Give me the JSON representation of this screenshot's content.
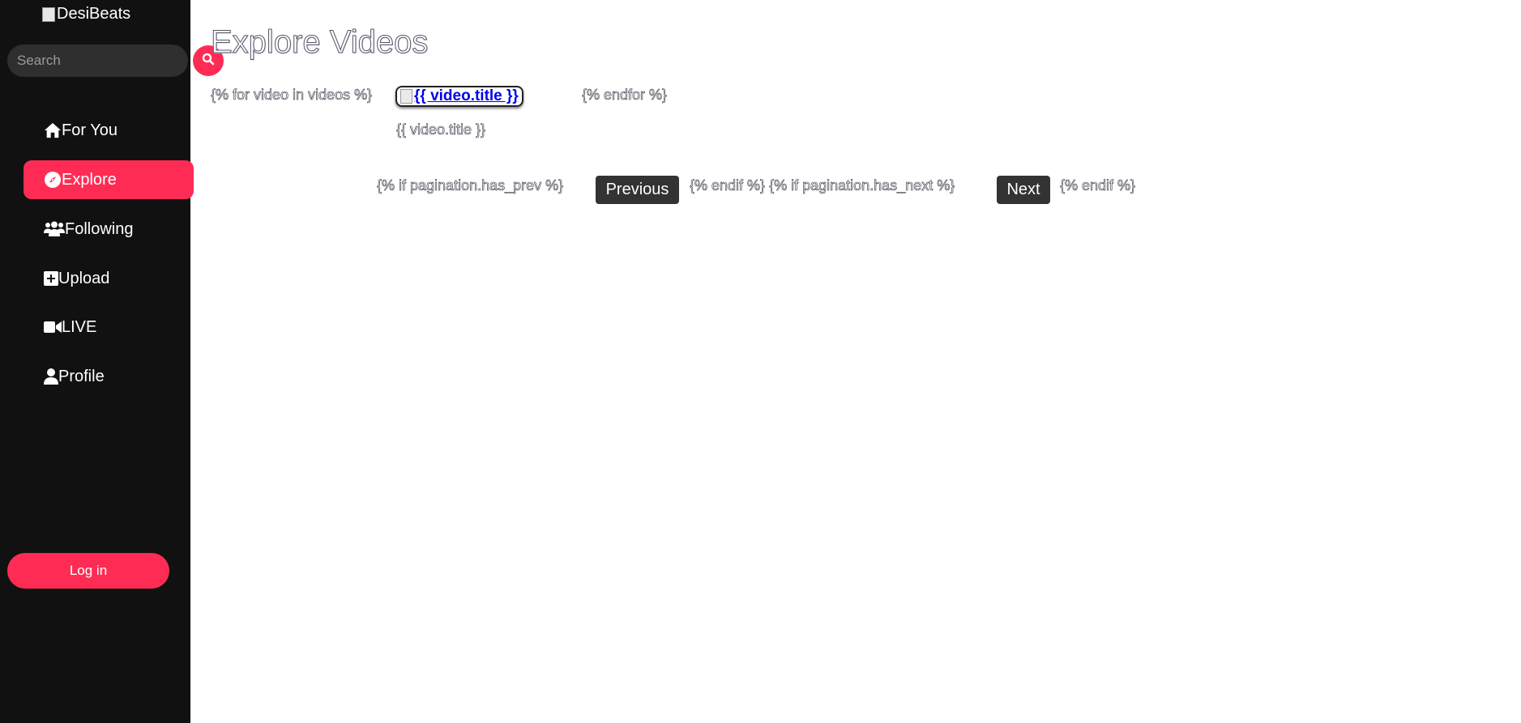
{
  "sidebar": {
    "logo_alt": "DesiBeats",
    "search": {
      "placeholder": "Search",
      "value": ""
    },
    "nav": [
      {
        "label": "For You",
        "icon": "home-icon",
        "active": false
      },
      {
        "label": "Explore",
        "icon": "compass-icon",
        "active": true
      },
      {
        "label": "Following",
        "icon": "users-icon",
        "active": false
      },
      {
        "label": "Upload",
        "icon": "upload-icon",
        "active": false
      },
      {
        "label": "LIVE",
        "icon": "video-camera-icon",
        "active": false
      },
      {
        "label": "Profile",
        "icon": "user-icon",
        "active": false
      }
    ],
    "login_label": "Log in"
  },
  "main": {
    "title": "Explore Videos",
    "loop_start": "{% for video in videos %}",
    "video_link_text": "{{ video.title }}",
    "video_caption": "{{ video.title }}",
    "loop_end": "{% endfor %}",
    "pagination": {
      "if_prev": "{% if pagination.has_prev %}",
      "prev_label": "Previous",
      "endif_if_next": "{% endif %} {% if pagination.has_next %}",
      "next_label": "Next",
      "endif": "{% endif %}"
    }
  },
  "colors": {
    "accent": "#fe2c55",
    "sidebar_bg": "#111111",
    "button_dark": "#333333"
  }
}
